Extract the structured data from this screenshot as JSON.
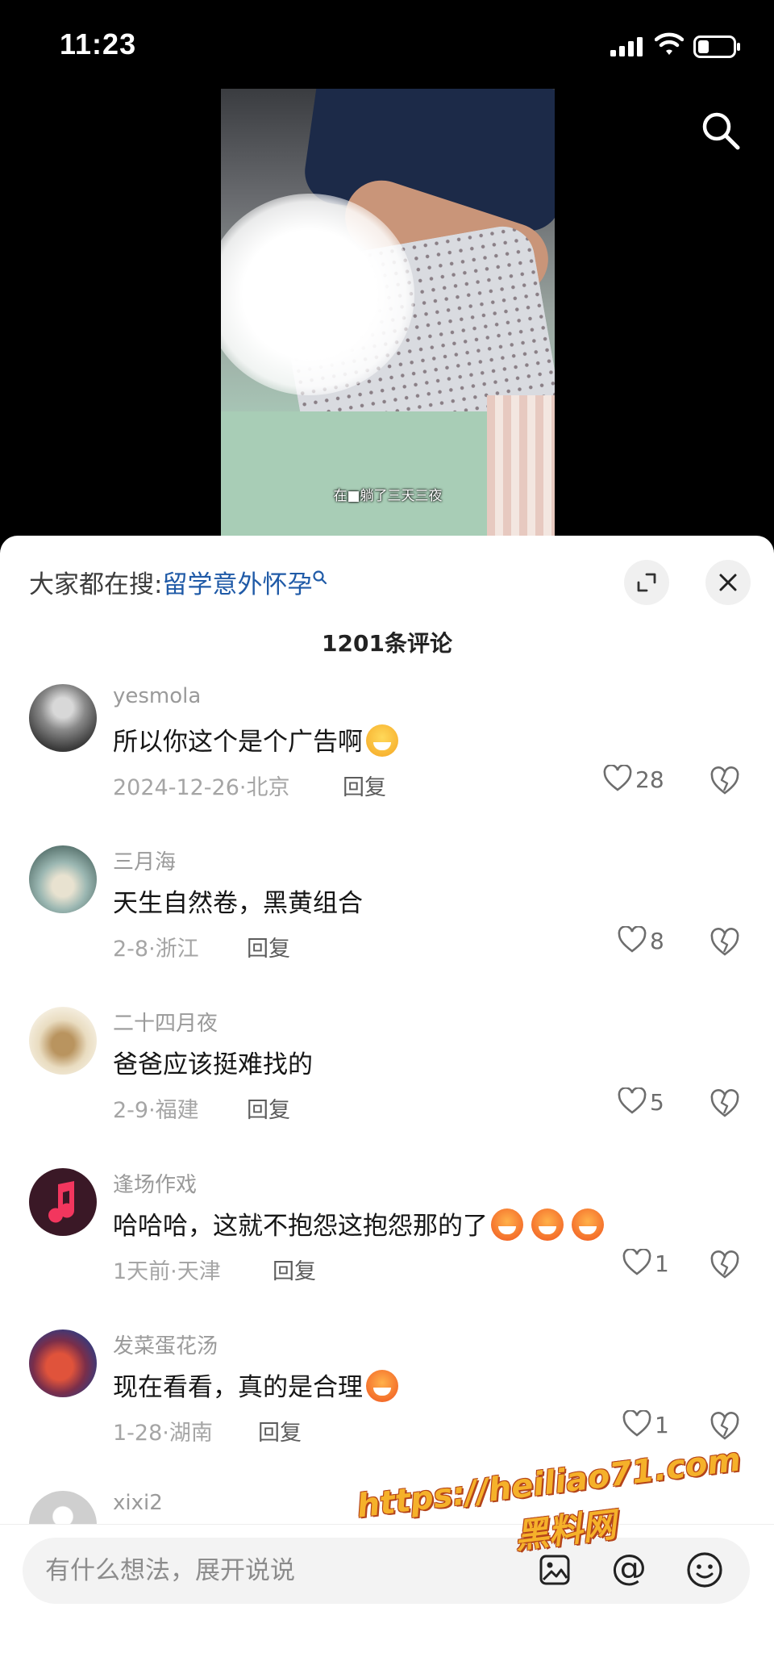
{
  "status_bar": {
    "time": "11:23"
  },
  "video": {
    "caption": "在■躺了三天三夜"
  },
  "trending": {
    "prefix": "大家都在搜:",
    "query": "留学意外怀孕"
  },
  "comments_header": {
    "count_text": "1201条评论"
  },
  "comments": [
    {
      "username": "yesmola",
      "text": "所以你这个是个广告啊",
      "emoji": "laugh-emoji",
      "meta": "2024-12-26·北京",
      "reply": "回复",
      "likes": "28"
    },
    {
      "username": "三月海",
      "text": "天生自然卷，黑黄组合",
      "meta": "2-8·浙江",
      "reply": "回复",
      "likes": "8"
    },
    {
      "username": "二十四月夜",
      "text": "爸爸应该挺难找的",
      "meta": "2-9·福建",
      "reply": "回复",
      "likes": "5"
    },
    {
      "username": "逢场作戏",
      "text": "哈哈哈，这就不抱怨这抱怨那的了",
      "emoji": "angry-laugh-emoji x3",
      "meta": "1天前·天津",
      "reply": "回复",
      "likes": "1"
    },
    {
      "username": "发菜蛋花汤",
      "text": "现在看看，真的是合理",
      "emoji": "angry-laugh-emoji",
      "meta": "1-28·湖南",
      "reply": "回复",
      "likes": "1"
    },
    {
      "username": "xixi2"
    }
  ],
  "input": {
    "placeholder": "有什么想法，展开说说"
  },
  "watermark": {
    "url": "https://heiliao71.com",
    "name": "黑料网"
  },
  "colors": {
    "link": "#1f5aa7",
    "watermark": "#f5b12a"
  }
}
